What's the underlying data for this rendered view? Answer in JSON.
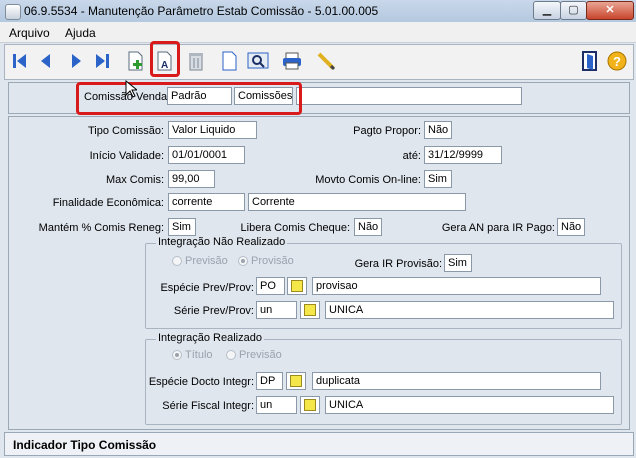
{
  "window": {
    "title": "06.9.5534 - Manutenção Parâmetro Estab Comissão - 5.01.00.005",
    "minimize": "▁",
    "maximize": "▢",
    "close": "✕"
  },
  "menu": {
    "items": [
      {
        "label": "Arquivo"
      },
      {
        "label": "Ajuda"
      }
    ]
  },
  "toolbar": {
    "icons": [
      "first-icon",
      "previous-icon",
      "next-icon",
      "last-icon",
      "add-icon",
      "edit-icon",
      "delete-icon",
      "document-icon",
      "zoom-icon",
      "print-icon",
      "pencil-icon",
      "exit-icon",
      "help-icon"
    ]
  },
  "header": {
    "comissao_venda_label": "Comissão Venda:",
    "comissao_venda_code": "Padrão",
    "comissao_venda_desc": "Comissões",
    "comissao_venda_extra": ""
  },
  "form": {
    "tipo_comissao_label": "Tipo Comissão:",
    "tipo_comissao_value": "Valor Liquido",
    "pagto_propor_label": "Pagto Propor:",
    "pagto_propor_value": "Não",
    "inicio_validade_label": "Início Validade:",
    "inicio_validade_value": "01/01/0001",
    "ate_label": "até:",
    "ate_value": "31/12/9999",
    "max_comis_label": "Max Comis:",
    "max_comis_value": "99,00",
    "movto_comis_label": "Movto Comis On-line:",
    "movto_comis_value": "Sim",
    "finalidade_label": "Finalidade Econômica:",
    "finalidade_code": "corrente",
    "finalidade_desc": "Corrente",
    "mantem_label": "Mantém % Comis Reneg:",
    "mantem_value": "Sim",
    "libera_label": "Libera Comis Cheque:",
    "libera_value": "Não",
    "gera_an_label": "Gera AN para IR Pago:",
    "gera_an_value": "Não"
  },
  "integracao_nao_realizado": {
    "title": "Integração Não Realizado",
    "radio_previsao": "Previsão",
    "radio_provisao": "Provisão",
    "gera_ir_label": "Gera IR Provisão:",
    "gera_ir_value": "Sim",
    "especie_label": "Espécie Prev/Prov:",
    "especie_code": "PO",
    "especie_desc": "provisao",
    "serie_label": "Série Prev/Prov:",
    "serie_code": "un",
    "serie_desc": "UNICA"
  },
  "integracao_realizado": {
    "title": "Integração Realizado",
    "radio_titulo": "Título",
    "radio_previsao": "Previsão",
    "especie_label": "Espécie Docto Integr:",
    "especie_code": "DP",
    "especie_desc": "duplicata",
    "serie_label": "Série Fiscal Integr:",
    "serie_code": "un",
    "serie_desc": "UNICA"
  },
  "status": {
    "text": "Indicador Tipo Comissão"
  },
  "colors": {
    "highlight": "#d91a1a",
    "background": "#dfe6ee",
    "toolbar_blue": "#2b63c8"
  }
}
